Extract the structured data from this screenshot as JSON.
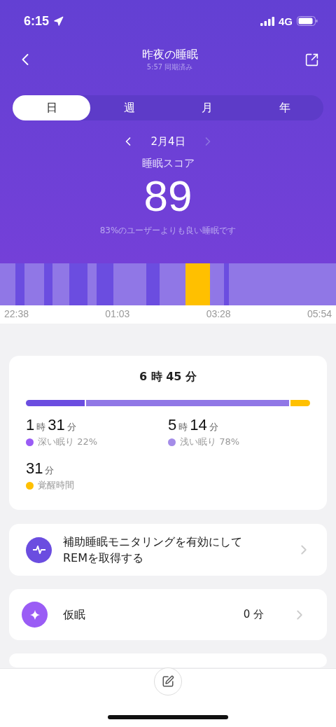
{
  "status_bar": {
    "time": "6:15",
    "network": "4G"
  },
  "header": {
    "title": "昨夜の睡眠",
    "subtitle": "5:57 同期済み"
  },
  "tabs": [
    {
      "label": "日",
      "selected": true
    },
    {
      "label": "週",
      "selected": false
    },
    {
      "label": "月",
      "selected": false
    },
    {
      "label": "年",
      "selected": false
    }
  ],
  "date_nav": {
    "date": "2月4日",
    "next_disabled": true
  },
  "score": {
    "label": "睡眠スコア",
    "value": "89",
    "caption": "83%のユーザーよりも良い睡眠です"
  },
  "timeline": {
    "times": [
      "22:38",
      "01:03",
      "03:28",
      "05:54"
    ]
  },
  "summary": {
    "total_hours": "6",
    "hours_unit": "時",
    "total_minutes": "45",
    "minutes_unit": "分",
    "stages": [
      {
        "hours": "1",
        "minutes": "31",
        "hours_unit": "時",
        "minutes_unit": "分",
        "label": "深い眠り 22%",
        "color": "#9a5cf5"
      },
      {
        "hours": "5",
        "minutes": "14",
        "hours_unit": "時",
        "minutes_unit": "分",
        "label": "浅い眠り 78%",
        "color": "#a48ce8"
      },
      {
        "minutes": "31",
        "minutes_unit": "分",
        "label": "覚醒時間",
        "color": "#ffc000"
      }
    ]
  },
  "rows": [
    {
      "kind": "monitor",
      "text": "補助睡眠モニタリングを有効にして\nREMを取得する"
    },
    {
      "kind": "nap",
      "text": "仮眠",
      "value": "0",
      "unit": "分"
    }
  ]
}
